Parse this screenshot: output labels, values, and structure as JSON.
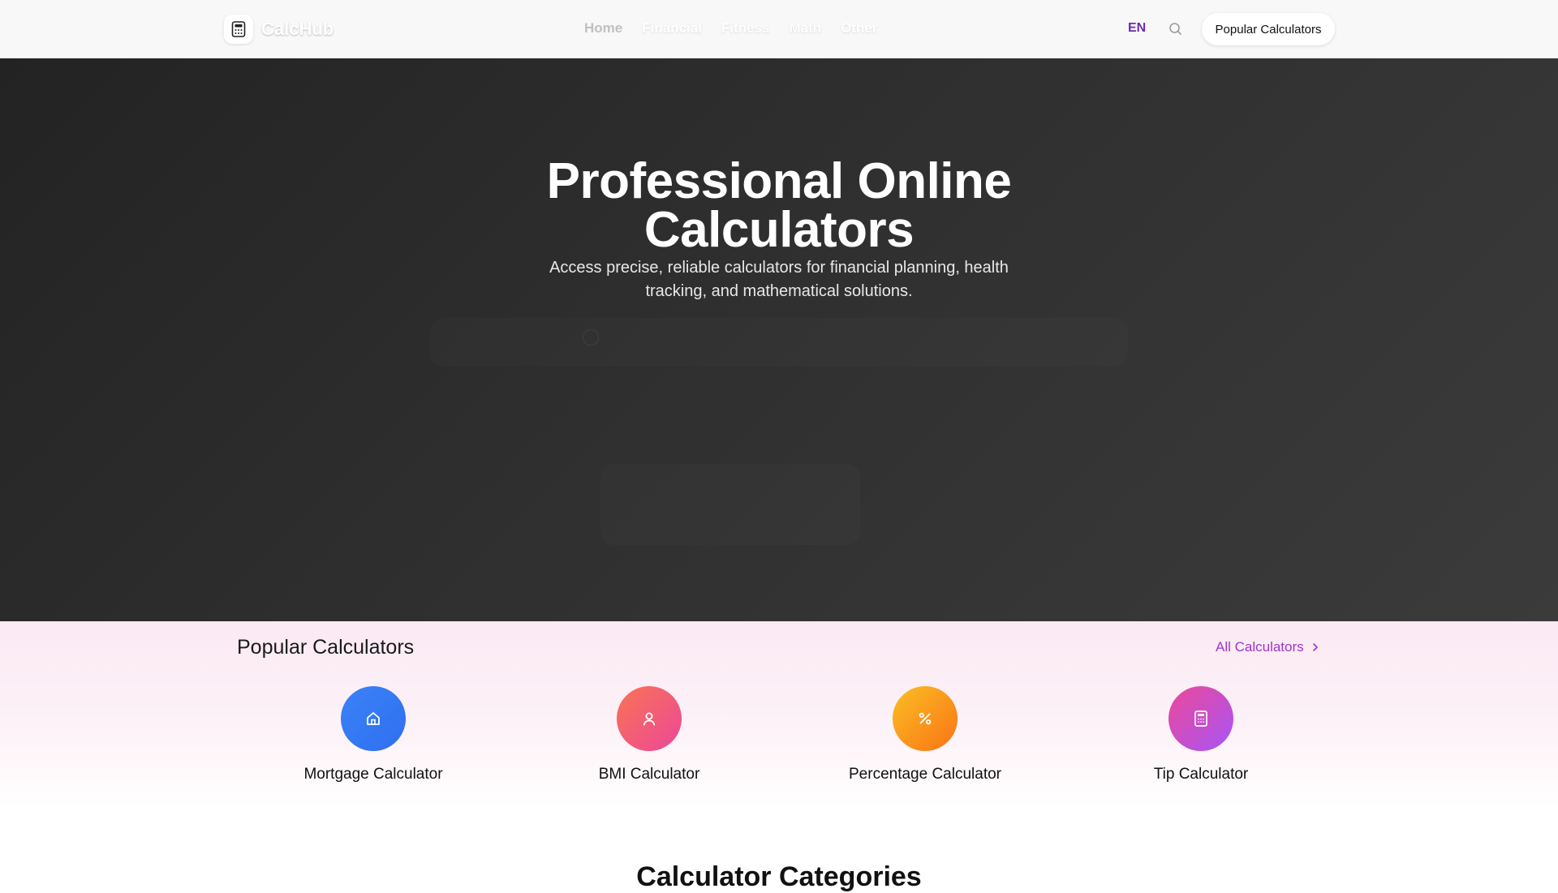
{
  "header": {
    "brand": "CalcHub",
    "nav": [
      "Home",
      "Financial",
      "Fitness",
      "Math",
      "Other"
    ],
    "language": "EN",
    "cta": "Popular Calculators"
  },
  "hero": {
    "title": "Professional Online Calculators",
    "subtitle": "Access precise, reliable calculators for financial planning, health tracking, and mathematical solutions."
  },
  "popular": {
    "title": "Popular Calculators",
    "all_link": "All Calculators",
    "items": [
      {
        "label": "Mortgage Calculator",
        "icon": "home-icon",
        "color": "#3b82f6"
      },
      {
        "label": "BMI Calculator",
        "icon": "user-icon",
        "color": "#f0537a"
      },
      {
        "label": "Percentage Calculator",
        "icon": "percent-icon",
        "color": "#f99a0f"
      },
      {
        "label": "Tip Calculator",
        "icon": "calculator-icon",
        "color": "#c048d6"
      }
    ]
  },
  "categories": {
    "title": "Calculator Categories"
  },
  "colors": {
    "accent": "#a233cf",
    "lang": "#6b2bb8"
  }
}
